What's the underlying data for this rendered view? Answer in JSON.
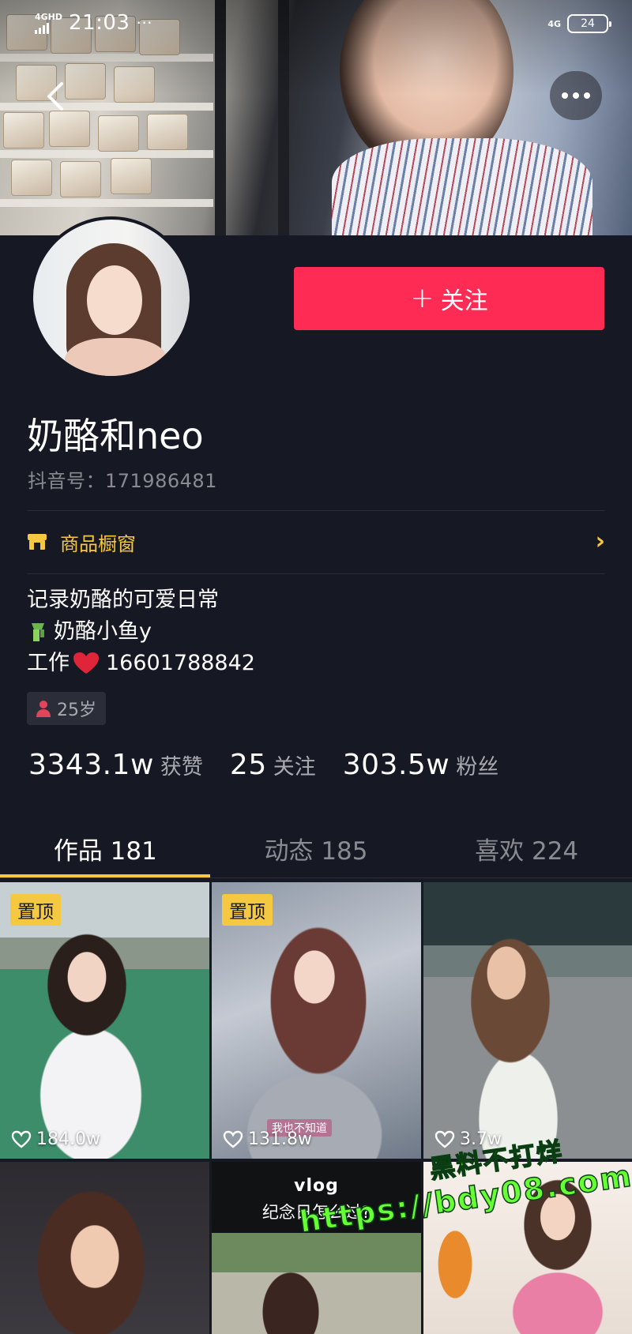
{
  "status_bar": {
    "network": "4GHD",
    "time": "21:03",
    "time_suffix": "···",
    "right_network": "4G",
    "battery": "24"
  },
  "profile": {
    "nickname": "奶酪和neo",
    "douyin_id": "抖音号：171986481",
    "follow_button": "关注",
    "shop_window": "商品橱窗",
    "bio_line1": "记录奶酪的可爱日常",
    "bio_line2": "奶酪小鱼y",
    "bio_line3_prefix": "工作",
    "bio_line3_number": "16601788842",
    "age": "25岁"
  },
  "stats": {
    "likes_value": "3343.1w",
    "likes_label": "获赞",
    "following_value": "25",
    "following_label": "关注",
    "followers_value": "303.5w",
    "followers_label": "粉丝"
  },
  "tabs": [
    {
      "label": "作品 181",
      "active": true
    },
    {
      "label": "动态 185",
      "active": false
    },
    {
      "label": "喜欢 224",
      "active": false
    }
  ],
  "videos": [
    {
      "pinned": "置顶",
      "likes": "184.0w"
    },
    {
      "pinned": "置顶",
      "likes": "131.8w",
      "caption": "我也不知道"
    },
    {
      "pinned": "",
      "likes": "3.7w"
    },
    {
      "pinned": "",
      "likes": ""
    },
    {
      "pinned": "",
      "likes": "",
      "title": "vlog",
      "subtitle": "纪念日怎么过?"
    },
    {
      "pinned": "",
      "likes": ""
    }
  ],
  "watermark": {
    "line1": "黑料不打烊",
    "line2": "https://bdy08.com"
  },
  "colors": {
    "background": "#161823",
    "follow_button": "#fe2c55",
    "accent_yellow": "#f5c842",
    "secondary_text": "#8a8b91"
  },
  "icons": [
    "back-arrow-icon",
    "more-icon",
    "plus-icon",
    "shop-icon",
    "chevron-right-icon",
    "scarf-emoji-icon",
    "heart-emoji-icon",
    "female-icon",
    "heart-outline-icon"
  ]
}
